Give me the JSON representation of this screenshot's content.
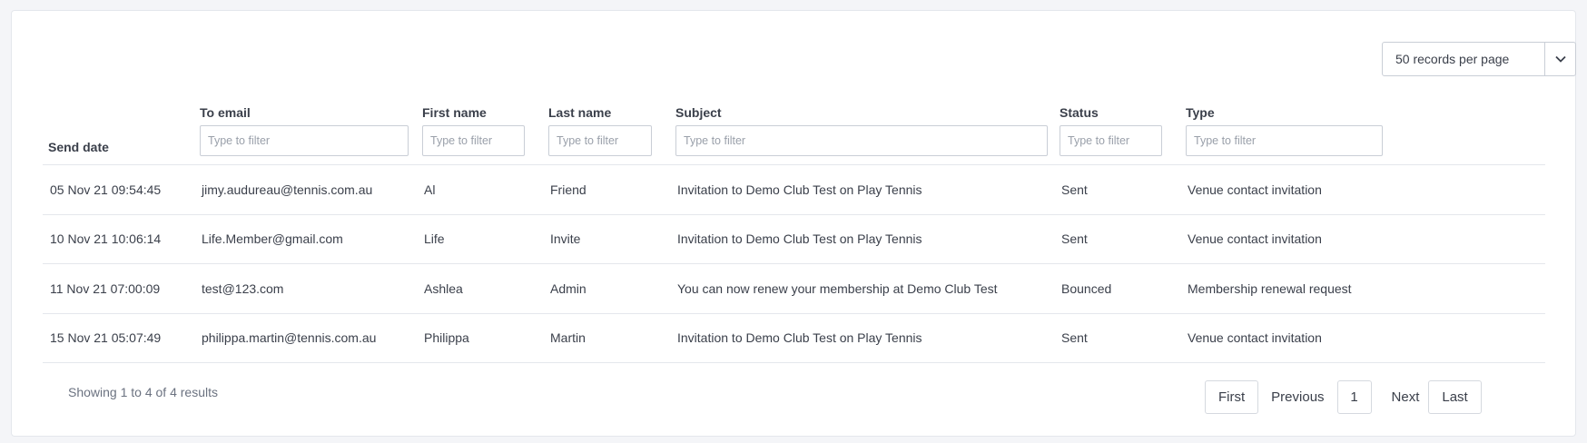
{
  "toolbar": {
    "per_page_label": "50 records per page"
  },
  "table": {
    "columns": [
      {
        "label": "Send date",
        "placeholder": ""
      },
      {
        "label": "To email",
        "placeholder": "Type to filter"
      },
      {
        "label": "First name",
        "placeholder": "Type to filter"
      },
      {
        "label": "Last name",
        "placeholder": "Type to filter"
      },
      {
        "label": "Subject",
        "placeholder": "Type to filter"
      },
      {
        "label": "Status",
        "placeholder": "Type to filter"
      },
      {
        "label": "Type",
        "placeholder": "Type to filter"
      }
    ],
    "rows": [
      [
        "05 Nov 21 09:54:45",
        "jimy.audureau@tennis.com.au",
        "Al",
        "Friend",
        "Invitation to Demo Club Test on Play Tennis",
        "Sent",
        "Venue contact invitation"
      ],
      [
        "10 Nov 21 10:06:14",
        "Life.Member@gmail.com",
        "Life",
        "Invite",
        "Invitation to Demo Club Test on Play Tennis",
        "Sent",
        "Venue contact invitation"
      ],
      [
        "11 Nov 21 07:00:09",
        "test@123.com",
        "Ashlea",
        "Admin",
        "You can now renew your membership at Demo Club Test",
        "Bounced",
        "Membership renewal request"
      ],
      [
        "15 Nov 21 05:07:49",
        "philippa.martin@tennis.com.au",
        "Philippa",
        "Martin",
        "Invitation to Demo Club Test on Play Tennis",
        "Sent",
        "Venue contact invitation"
      ]
    ]
  },
  "footer": {
    "info": "Showing 1 to 4 of 4 results"
  },
  "pagination": {
    "first": "First",
    "previous": "Previous",
    "current_page": "1",
    "next": "Next",
    "last": "Last"
  },
  "icons": {
    "per_page_caret": "chevron-down-icon"
  }
}
